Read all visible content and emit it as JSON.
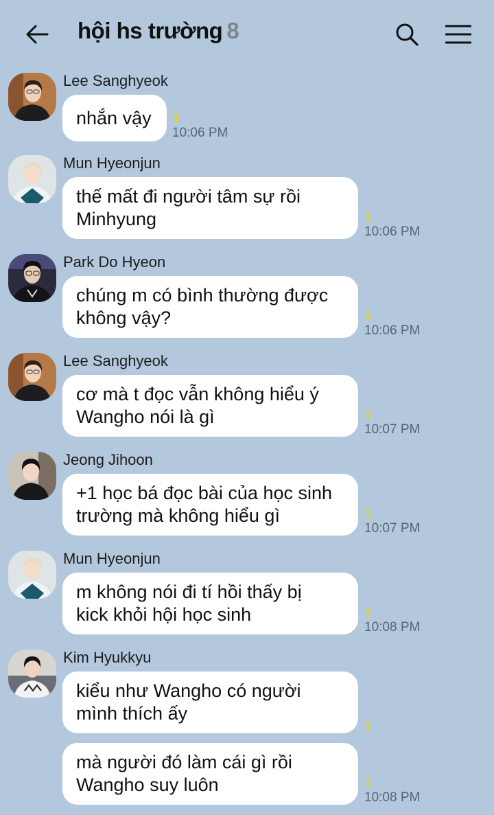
{
  "header": {
    "title": "hội hs trường",
    "member_count": "8",
    "back_icon": "arrow-left-icon",
    "search_icon": "search-icon",
    "menu_icon": "hamburger-menu-icon"
  },
  "colors": {
    "background": "#b3c8dd",
    "bubble": "#ffffff",
    "unread": "#e8d21a",
    "time": "#5b6470",
    "member_count": "#7d8790"
  },
  "messages": [
    {
      "sender": "Lee Sanghyeok",
      "text": "nhắn vậy",
      "unread": "1",
      "time": "10:06 PM"
    },
    {
      "sender": "Mun Hyeonjun",
      "text": "thế mất đi người tâm sự rồi\nMinhyung",
      "unread": "1",
      "time": "10:06 PM"
    },
    {
      "sender": "Park Do Hyeon",
      "text": "chúng m có bình thường được\nkhông vậy?",
      "unread": "1",
      "time": "10:06 PM"
    },
    {
      "sender": "Lee Sanghyeok",
      "text": "cơ mà t đọc vẫn không hiểu ý\nWangho nói là gì",
      "unread": "1",
      "time": "10:07 PM"
    },
    {
      "sender": "Jeong Jihoon",
      "text": "+1 học bá đọc bài của học sinh\ntrường mà không hiểu gì",
      "unread": "1",
      "time": "10:07 PM"
    },
    {
      "sender": "Mun Hyeonjun",
      "text": "m không nói đi tí hồi thấy bị\nkick khỏi hội học sinh",
      "unread": "1",
      "time": "10:08 PM"
    },
    {
      "sender": "Kim Hyukkyu",
      "text": "kiểu như Wangho có người\nmình thích ấy",
      "unread": "1",
      "time": ""
    },
    {
      "sender": "",
      "text": "mà người đó làm cái gì rồi\nWangho suy luôn",
      "unread": "1",
      "time": "10:08 PM"
    }
  ]
}
